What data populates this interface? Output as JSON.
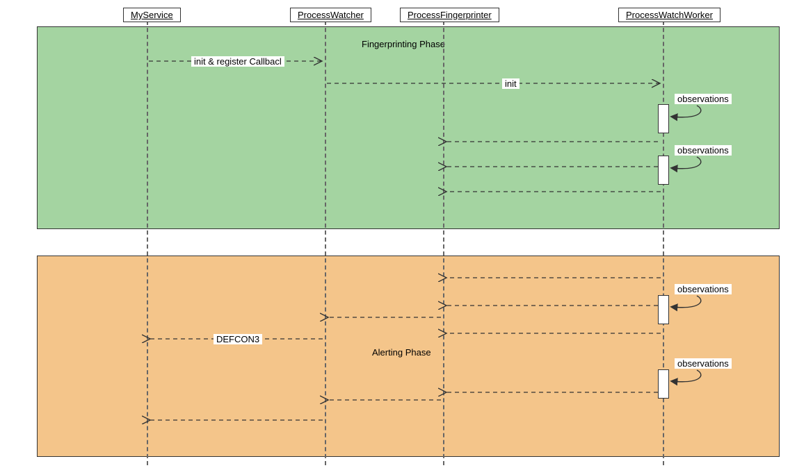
{
  "diagram": {
    "participants": {
      "p1": "MyService",
      "p2": "ProcessWatcher",
      "p3": "ProcessFingerprinter",
      "p4": "ProcessWatchWorker"
    },
    "phases": {
      "green_label": "Fingerprinting Phase",
      "orange_label": "Alerting Phase"
    },
    "messages": {
      "m1": "init & register Callbacl",
      "m2": "init",
      "m3": "observations",
      "m4": "observations",
      "m5": "observations",
      "m6": "observations",
      "m7": "DEFCON3"
    }
  },
  "chart_data": {
    "type": "sequence-diagram",
    "participants": [
      "MyService",
      "ProcessWatcher",
      "ProcessFingerprinter",
      "ProcessWatchWorker"
    ],
    "phases": [
      {
        "name": "Fingerprinting Phase",
        "color": "#a4d4a1",
        "messages": [
          {
            "from": "MyService",
            "to": "ProcessWatcher",
            "label": "init & register Callbacl",
            "style": "dashed",
            "dir": "forward"
          },
          {
            "from": "ProcessWatcher",
            "to": "ProcessWatchWorker",
            "label": "init",
            "style": "dashed",
            "dir": "forward"
          },
          {
            "from": "ProcessWatchWorker",
            "to": "ProcessWatchWorker",
            "label": "observations",
            "style": "self"
          },
          {
            "from": "ProcessWatchWorker",
            "to": "ProcessFingerprinter",
            "label": "",
            "style": "dashed",
            "dir": "return"
          },
          {
            "from": "ProcessWatchWorker",
            "to": "ProcessWatchWorker",
            "label": "observations",
            "style": "self"
          },
          {
            "from": "ProcessWatchWorker",
            "to": "ProcessFingerprinter",
            "label": "",
            "style": "dashed",
            "dir": "return"
          },
          {
            "from": "ProcessWatchWorker",
            "to": "ProcessFingerprinter",
            "label": "",
            "style": "dashed",
            "dir": "return"
          }
        ]
      },
      {
        "name": "Alerting Phase",
        "color": "#f4c58a",
        "messages": [
          {
            "from": "ProcessWatchWorker",
            "to": "ProcessFingerprinter",
            "label": "",
            "style": "dashed",
            "dir": "return"
          },
          {
            "from": "ProcessWatchWorker",
            "to": "ProcessWatchWorker",
            "label": "observations",
            "style": "self"
          },
          {
            "from": "ProcessWatchWorker",
            "to": "ProcessFingerprinter",
            "label": "",
            "style": "dashed",
            "dir": "return"
          },
          {
            "from": "ProcessFingerprinter",
            "to": "ProcessWatcher",
            "label": "",
            "style": "dashed",
            "dir": "return"
          },
          {
            "from": "ProcessWatchWorker",
            "to": "ProcessFingerprinter",
            "label": "",
            "style": "dashed",
            "dir": "return"
          },
          {
            "from": "ProcessWatcher",
            "to": "MyService",
            "label": "DEFCON3",
            "style": "dashed",
            "dir": "return"
          },
          {
            "from": "ProcessWatchWorker",
            "to": "ProcessWatchWorker",
            "label": "observations",
            "style": "self"
          },
          {
            "from": "ProcessWatchWorker",
            "to": "ProcessFingerprinter",
            "label": "",
            "style": "dashed",
            "dir": "return"
          },
          {
            "from": "ProcessFingerprinter",
            "to": "ProcessWatcher",
            "label": "",
            "style": "dashed",
            "dir": "return"
          },
          {
            "from": "ProcessWatcher",
            "to": "MyService",
            "label": "",
            "style": "dashed",
            "dir": "return"
          }
        ]
      }
    ]
  }
}
